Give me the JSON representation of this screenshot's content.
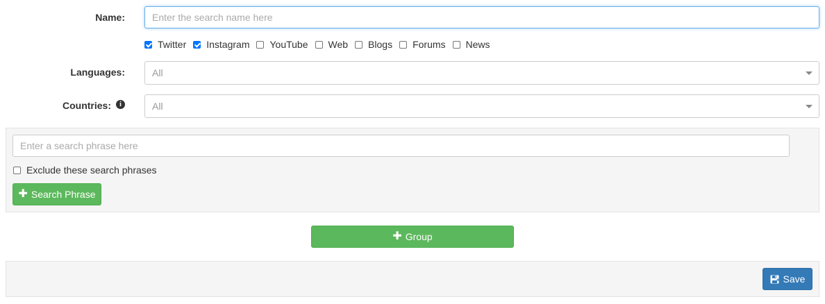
{
  "form": {
    "name_label": "Name:",
    "name_placeholder": "Enter the search name here",
    "channels": [
      {
        "label": "Twitter",
        "checked": true
      },
      {
        "label": "Instagram",
        "checked": true
      },
      {
        "label": "YouTube",
        "checked": false
      },
      {
        "label": "Web",
        "checked": false
      },
      {
        "label": "Blogs",
        "checked": false
      },
      {
        "label": "Forums",
        "checked": false
      },
      {
        "label": "News",
        "checked": false
      }
    ],
    "languages_label": "Languages:",
    "languages_value": "All",
    "countries_label": "Countries:",
    "countries_value": "All",
    "countries_info_icon": "info-circle-icon"
  },
  "group": {
    "phrase_placeholder": "Enter a search phrase here",
    "exclude_label": "Exclude these search phrases",
    "exclude_checked": false,
    "add_phrase_label": "Search Phrase",
    "add_phrase_icon": "plus-icon"
  },
  "add_group_label": "Group",
  "add_group_icon": "plus-icon",
  "footer": {
    "save_label": "Save",
    "save_icon": "save-icon"
  },
  "colors": {
    "success": "#5cb85c",
    "primary": "#337ab7",
    "checkbox_checked": "#0075ff",
    "panel_bg": "#f5f5f5"
  }
}
